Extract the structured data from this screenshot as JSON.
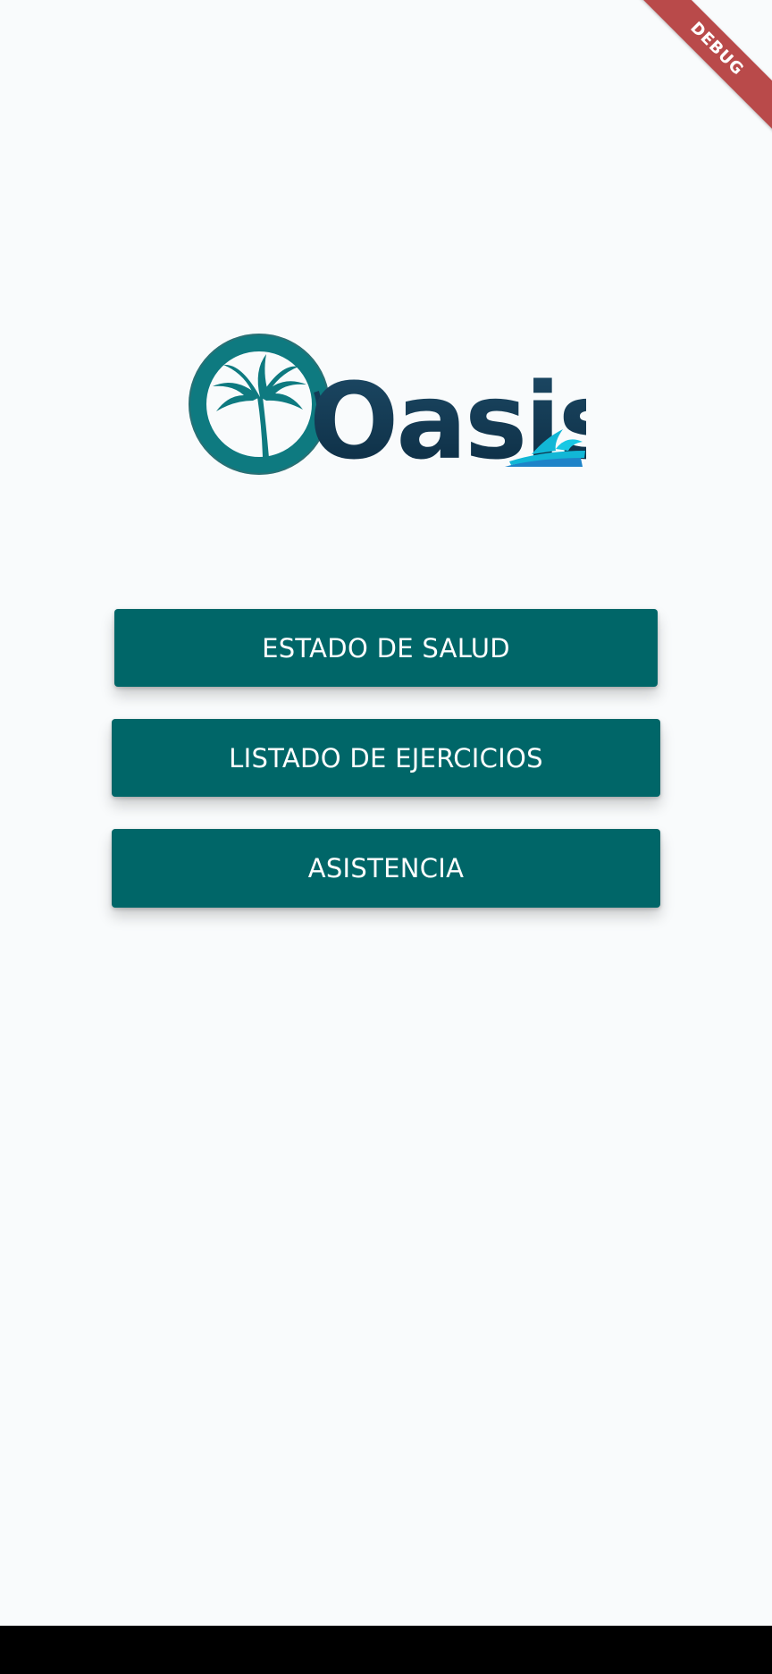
{
  "app": {
    "logo_text": "Oasis",
    "debug_banner": "DEBUG"
  },
  "menu": {
    "buttons": [
      {
        "label": "ESTADO DE SALUD"
      },
      {
        "label": "LISTADO DE EJERCICIOS"
      },
      {
        "label": "ASISTENCIA"
      }
    ]
  },
  "colors": {
    "background": "#f9fbfc",
    "button": "#006668",
    "button_text": "#ffffff",
    "logo_teal": "#0e7a80",
    "logo_navy": "#123c57",
    "logo_water": "#12b7d6",
    "debug_banner": "#b94a4a"
  },
  "icons": {
    "logo_mark": "palm-tree-circle-icon",
    "logo_water": "wave-splash-icon"
  }
}
